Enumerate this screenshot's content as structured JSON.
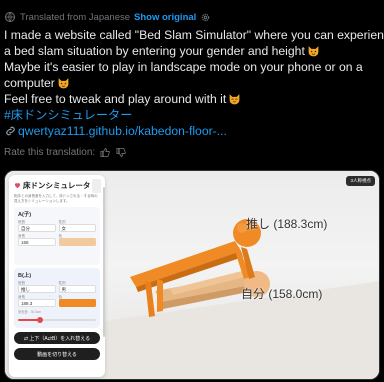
{
  "header": {
    "translated_from": "Translated from Japanese",
    "show_original": "Show original"
  },
  "tweet": {
    "line1": "I made a website called \"Bed Slam Simulator\" where you can experience",
    "line2": "a bed slam situation by entering your gender and height",
    "line3": "Maybe it's easier to play in landscape mode on your phone or on a",
    "line4": "computer",
    "line5": "Feel free to tweak and play around with it",
    "hashtag": "#床ドンシミュレーター",
    "link": "qwertyaz111.github.io/kabedon-floor-..."
  },
  "rate": {
    "label": "Rate this translation:"
  },
  "media": {
    "app_title": "床ドンシミュレータ",
    "description": "相手との身長差を入力して、床ドンされる・する時の見え方をシミュレーションします。",
    "person_a": {
      "title": "A(子)",
      "role_label": "役割",
      "role_value": "自分",
      "gender_label": "性別",
      "gender_value": "女",
      "height_label": "身長",
      "height_value": "158",
      "color_label": "色",
      "color": "#f3c9a0"
    },
    "person_b": {
      "title": "B(上)",
      "role_label": "役割",
      "role_value": "推し",
      "gender_label": "性別",
      "gender_value": "男",
      "height_label": "身長",
      "height_value": "188.3",
      "color_label": "色",
      "color": "#f08a24",
      "slider_fraction": 0.28,
      "hint": "身長差：30.3cm"
    },
    "swap_button": "⇄ 上下（A⇄B）を入れ替える",
    "save_button": "動画を切り替える",
    "mode_button": "3人称視点",
    "label_top": "推し (188.3cm)",
    "label_bottom": "自分 (158.0cm)"
  },
  "colors": {
    "accent": "#1d9bf0",
    "figure_orange": "#f08a24",
    "floor_wood": "#e3b07b"
  },
  "icons": [
    "globe-icon",
    "gear-icon",
    "smiling-cat-icon",
    "link-icon",
    "thumbs-up-icon",
    "thumbs-down-icon",
    "heart-icon"
  ]
}
